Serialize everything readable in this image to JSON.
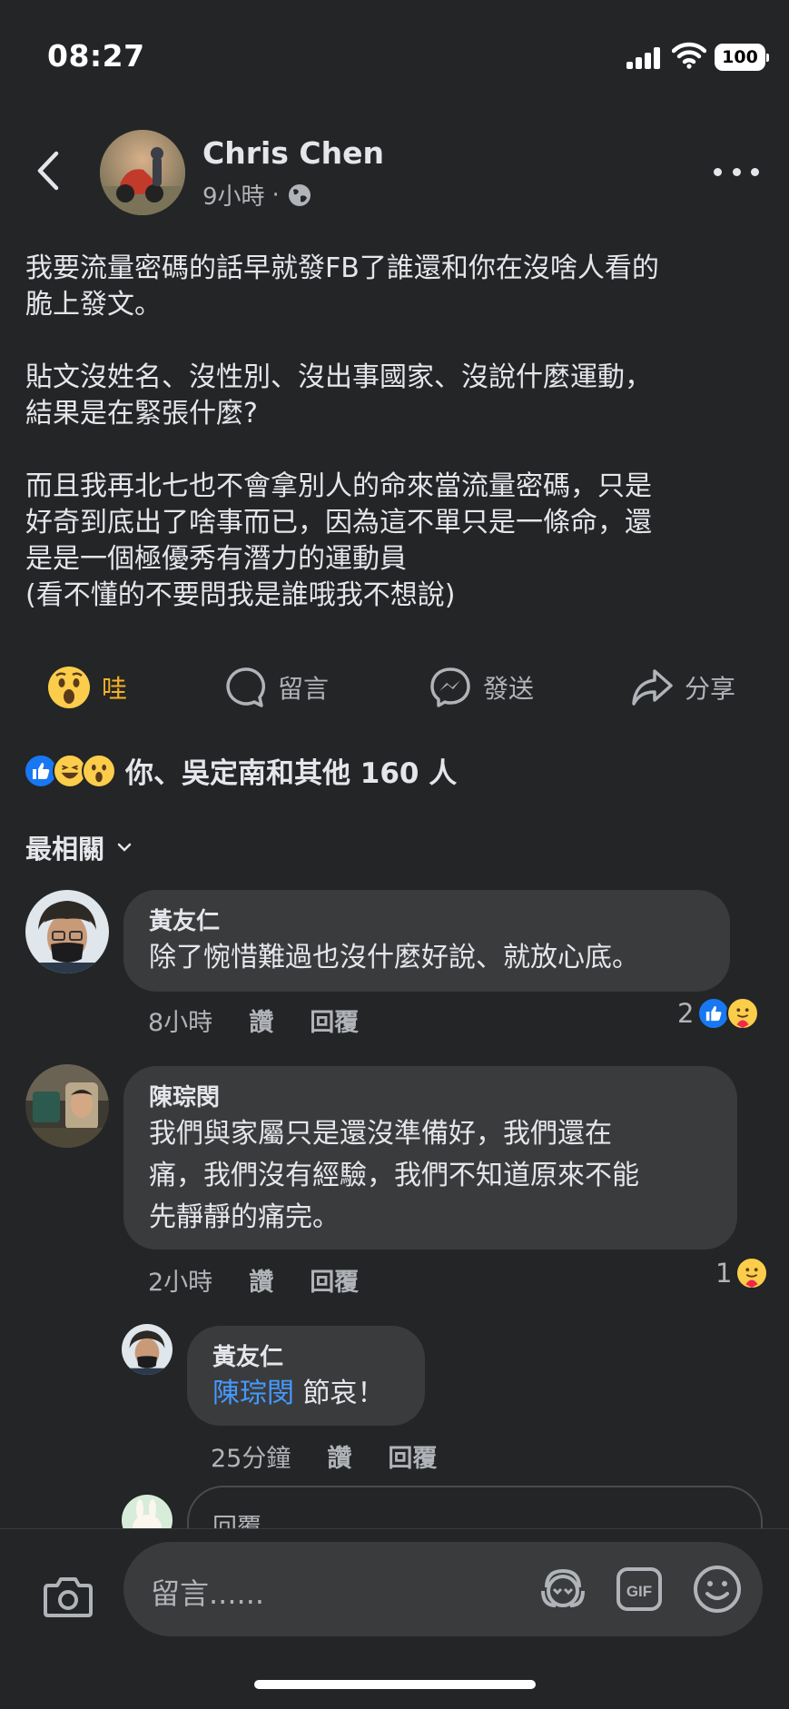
{
  "status_bar": {
    "time": "08:27",
    "battery": "100"
  },
  "post": {
    "author": "Chris Chen",
    "time": "9小時",
    "separator": "·",
    "paragraphs": [
      "我要流量密碼的話早就發FB了誰還和你在沒啥人看的\n脆上發文。",
      "貼文沒姓名、沒性別、沒出事國家、沒說什麼運動，\n結果是在緊張什麼?",
      "而且我再北七也不會拿別人的命來當流量密碼，只是\n好奇到底出了啥事而已，因為這不單只是一條命，還\n是是一個極優秀有潛力的運動員\n(看不懂的不要問我是誰哦我不想說)"
    ]
  },
  "actions": {
    "wow": "哇",
    "comment": "留言",
    "send": "發送",
    "share": "分享"
  },
  "reactions_summary": "你、吳定南和其他 160 人",
  "sort_label": "最相關",
  "comments": [
    {
      "name": "黃友仁",
      "text": "除了惋惜難過也沒什麼好說、就放心底。",
      "time": "8小時",
      "like": "讚",
      "reply": "回覆",
      "count": "2"
    },
    {
      "name": "陳琮閔",
      "text": "我們與家屬只是還沒準備好，我們還在\n痛，我們沒有經驗，我們不知道原來不能\n先靜靜的痛完。",
      "time": "2小時",
      "like": "讚",
      "reply": "回覆",
      "count": "1"
    }
  ],
  "reply": {
    "name": "黃友仁",
    "mention": "陳琮閔",
    "text": " 節哀！",
    "time": "25分鐘",
    "like": "讚",
    "reply": "回覆"
  },
  "reply_placeholder": "回覆",
  "composer": {
    "placeholder": "留言......",
    "gif": "GIF"
  },
  "colors": {
    "background": "#242526",
    "bubble": "#3a3b3c",
    "wow": "#f7b125",
    "mention": "#4599ff",
    "like_blue": "#1877f2"
  }
}
